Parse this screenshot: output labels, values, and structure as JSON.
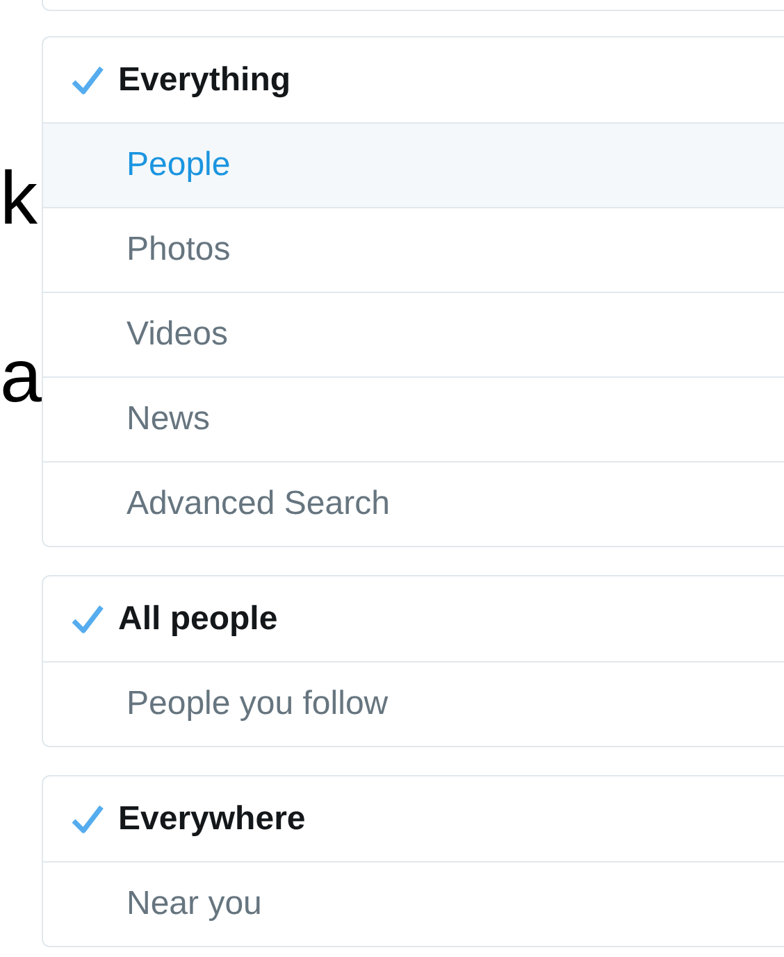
{
  "background_text": [
    "k",
    "a"
  ],
  "menus": [
    {
      "items": [
        {
          "label": "Everything",
          "kind": "header",
          "checked": true
        },
        {
          "label": "People",
          "kind": "option",
          "selected": true
        },
        {
          "label": "Photos",
          "kind": "option",
          "selected": false
        },
        {
          "label": "Videos",
          "kind": "option",
          "selected": false
        },
        {
          "label": "News",
          "kind": "option",
          "selected": false
        },
        {
          "label": "Advanced Search",
          "kind": "option",
          "selected": false
        }
      ]
    },
    {
      "items": [
        {
          "label": "All people",
          "kind": "header",
          "checked": true
        },
        {
          "label": "People you follow",
          "kind": "option",
          "selected": false
        }
      ]
    },
    {
      "items": [
        {
          "label": "Everywhere",
          "kind": "header",
          "checked": true
        },
        {
          "label": "Near you",
          "kind": "option",
          "selected": false
        }
      ]
    }
  ]
}
